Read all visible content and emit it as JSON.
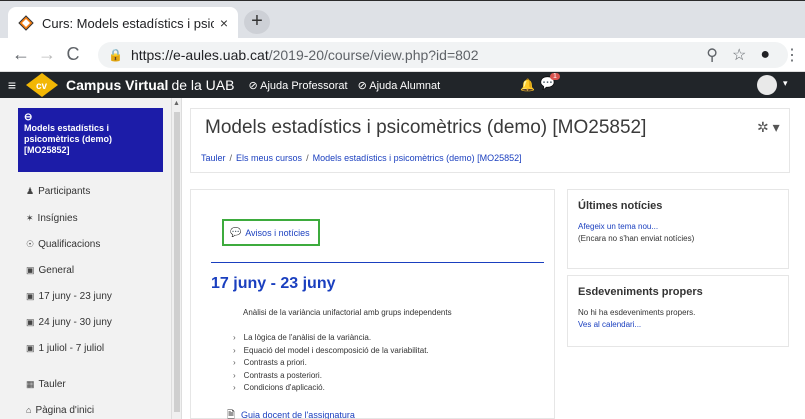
{
  "browser": {
    "tab_title": "Curs: Models estadístics i psicom",
    "tab_close": "×",
    "new_tab": "+",
    "back": "←",
    "forward": "→",
    "reload": "C",
    "url_host": "https://e-aules.uab.cat",
    "url_path": "/2019-20/course/view.php?id=802",
    "zoom_icon": "⚲",
    "star_icon": "☆",
    "profile_icon": "●",
    "menu_icon": "⋮"
  },
  "navbar": {
    "menu": "≡",
    "brand_bold": "Campus Virtual",
    "brand_rest": "de la UAB",
    "link1": "Ajuda Professorat",
    "link2": "Ajuda Alumnat",
    "badge": "1",
    "avatar_caret": "▾"
  },
  "drawer": {
    "active_course": "Models estadístics i psicomètrics (demo) [MO25852]",
    "items": [
      "Participants",
      "Insígnies",
      "Qualificacions",
      "General",
      "17 juny - 23 juny",
      "24 juny - 30 juny",
      "1 juliol - 7 juliol",
      "Tauler",
      "Pàgina d'inici"
    ]
  },
  "header": {
    "title": "Models estadístics i psicomètrics (demo) [MO25852]",
    "breadcrumbs": [
      "Tauler",
      "Els meus cursos",
      "Models estadístics i psicomètrics (demo) [MO25852]"
    ],
    "gear": "✲ ▾"
  },
  "main": {
    "avisos": "Avisos i notícies",
    "section_title": "17 juny - 23 juny",
    "summary": "Anàlisi de la variància unifactorial amb grups independents",
    "bullets": [
      "La lògica de l'anàlisi de la variància.",
      "Equació del model i descomposició de la variabilitat.",
      "Contrasts a priori.",
      "Contrasts a posteriori.",
      "Condicions d'aplicació."
    ],
    "guia": "Guia docent de l'assignatura"
  },
  "blocks": {
    "news_title": "Últimes notícies",
    "news_add": "Afegeix un tema nou...",
    "news_empty": "(Encara no s'han enviat notícies)",
    "events_title": "Esdeveniments propers",
    "events_empty": "No hi ha esdeveniments propers.",
    "events_calendar": "Ves al calendari..."
  }
}
